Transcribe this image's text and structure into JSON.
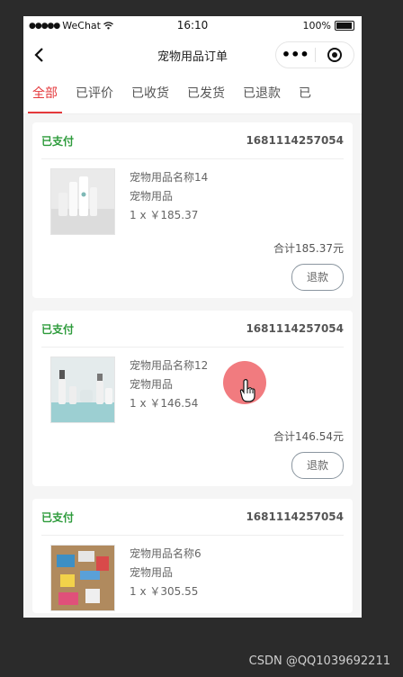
{
  "status_bar": {
    "carrier": "WeChat",
    "time": "16:10",
    "battery": "100%"
  },
  "nav": {
    "title": "宠物用品订单"
  },
  "tabs": [
    {
      "label": "全部",
      "active": true
    },
    {
      "label": "已评价"
    },
    {
      "label": "已收货"
    },
    {
      "label": "已发货"
    },
    {
      "label": "已退款"
    },
    {
      "label": "已"
    }
  ],
  "orders": [
    {
      "status": "已支付",
      "order_no": "1681114257054",
      "item_name": "宠物用品名称14",
      "category": "宠物用品",
      "qty_price": "1 x ￥185.37",
      "total": "合计185.37元",
      "action": "退款"
    },
    {
      "status": "已支付",
      "order_no": "1681114257054",
      "item_name": "宠物用品名称12",
      "category": "宠物用品",
      "qty_price": "1 x ￥146.54",
      "total": "合计146.54元",
      "action": "退款"
    },
    {
      "status": "已支付",
      "order_no": "1681114257054",
      "item_name": "宠物用品名称6",
      "category": "宠物用品",
      "qty_price": "1 x ￥305.55",
      "total": "",
      "action": ""
    }
  ],
  "watermark": "CSDN @QQ1039692211",
  "colors": {
    "accent": "#e4393c",
    "paid": "#2d9b3b"
  }
}
